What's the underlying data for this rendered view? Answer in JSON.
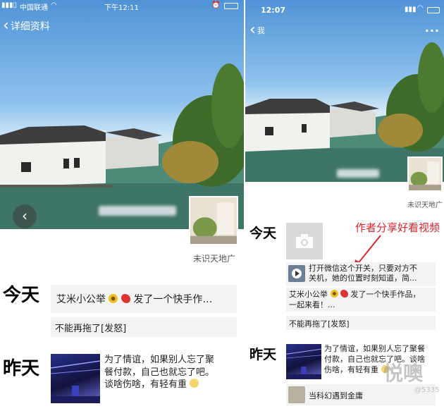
{
  "left": {
    "status": {
      "carrier": "中国联通",
      "time": "下午12:11"
    },
    "nav": {
      "back_label": "详细资料"
    },
    "nickname": "未识天地广",
    "today_label": "今天",
    "yesterday_label": "昨天",
    "today_cards": [
      {
        "text_before": "艾米小公举",
        "text_after": "发了一个快手作…"
      },
      {
        "text": "不能再拖了[发怒]"
      }
    ],
    "yesterday_post": {
      "line1": "为了情谊，如果别人忘了聚",
      "line2": "餐付款，自己也就忘了吧。",
      "line3": "谈啥伤啥，有轻有重"
    }
  },
  "right": {
    "status": {
      "time": "12:07"
    },
    "nav": {
      "back_label": "我"
    },
    "nickname": "未识天地广",
    "annotation": "作者分享好看视频",
    "today_label": "今天",
    "yesterday_label": "昨天",
    "share_card": {
      "line1": "打开微信这个开关，只要对方不",
      "line2": "关机，她的位置时刻知道，简..."
    },
    "today_cards": [
      {
        "line1_before": "艾米小公举",
        "line1_after": "发了一个快手作品，",
        "line2": "一起来看！..."
      },
      {
        "text": "不能再拖了[发怒]"
      }
    ],
    "yesterday_post": {
      "line1": "为了情谊，如果别人忘了聚餐",
      "line2": "付款，自己也就忘了吧。谈啥",
      "line3": "伤啥，有轻有重"
    },
    "last_card": "当科幻遇到金庸",
    "watermark": "悦噢",
    "watermark_id": "@5335"
  },
  "colors": {
    "annotation": "#e0242b",
    "card_bg": "#f3f3f3"
  },
  "icons": [
    "wifi-icon",
    "battery-icon",
    "back-chevron-icon",
    "camera-icon",
    "play-icon",
    "sunflower-emoji",
    "rooster-emoji",
    "face-emoji"
  ]
}
